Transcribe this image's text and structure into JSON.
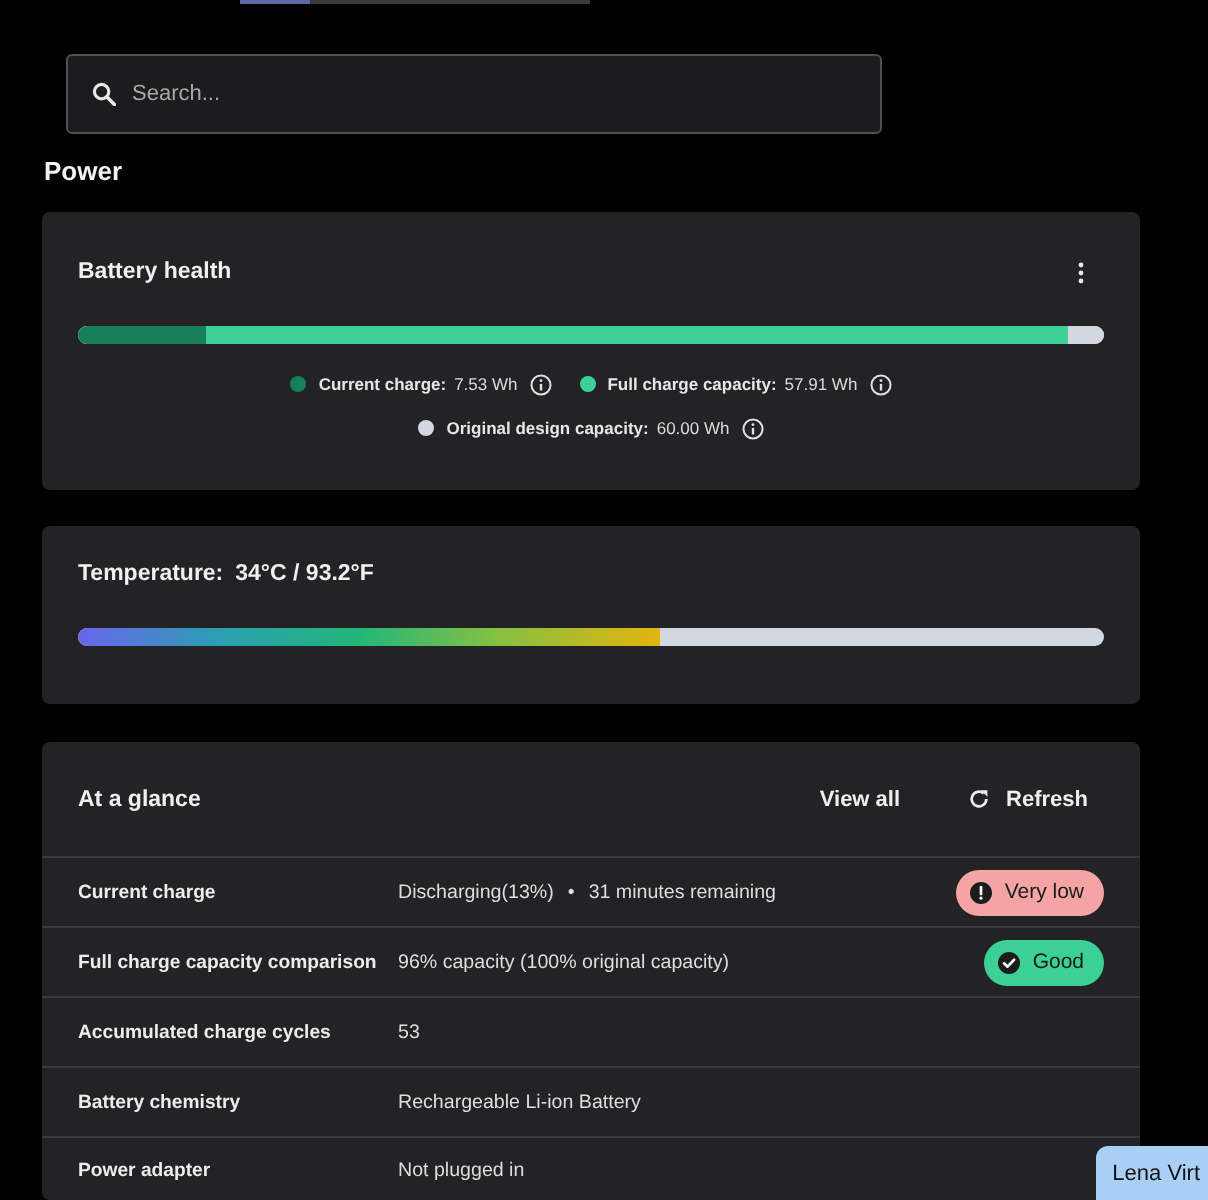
{
  "search": {
    "placeholder": "Search..."
  },
  "section_title": "Power",
  "battery_health": {
    "title": "Battery health",
    "legend": [
      {
        "label": "Current charge:",
        "value": "7.53 Wh",
        "color": "#15805a",
        "level": 0.1255
      },
      {
        "label": "Full charge capacity:",
        "value": "57.91 Wh",
        "color": "#3dd094",
        "level": 0.965
      },
      {
        "label": "Original design capacity:",
        "value": "60.00 Wh",
        "color": "#d3d7e0",
        "level": 1
      }
    ]
  },
  "temperature": {
    "label": "Temperature:",
    "value": "34°C / 93.2°F",
    "level": 0.567
  },
  "at_a_glance": {
    "title": "At a glance",
    "actions": [
      {
        "label": "View all",
        "kind": "link"
      },
      {
        "label": "Refresh",
        "kind": "refresh"
      }
    ],
    "rows": [
      {
        "label": "Current charge",
        "values": [
          "Discharging(13%)",
          "•",
          "31 minutes remaining"
        ],
        "badge": {
          "label": "Very low",
          "kind": "alert",
          "color": "#f4a4a4"
        }
      },
      {
        "label": "Full charge capacity comparison",
        "values": [
          "96% capacity (100% original capacity)"
        ],
        "badge": {
          "label": "Good",
          "kind": "ok",
          "color": "#3dd094"
        }
      },
      {
        "label": "Accumulated charge cycles",
        "values": [
          "53"
        ]
      },
      {
        "label": "Battery chemistry",
        "values": [
          "Rechargeable Li-ion Battery"
        ]
      },
      {
        "label": "Power adapter",
        "values": [
          "Not plugged in"
        ]
      }
    ]
  },
  "name_tag": {
    "label": "Lena Virt"
  }
}
